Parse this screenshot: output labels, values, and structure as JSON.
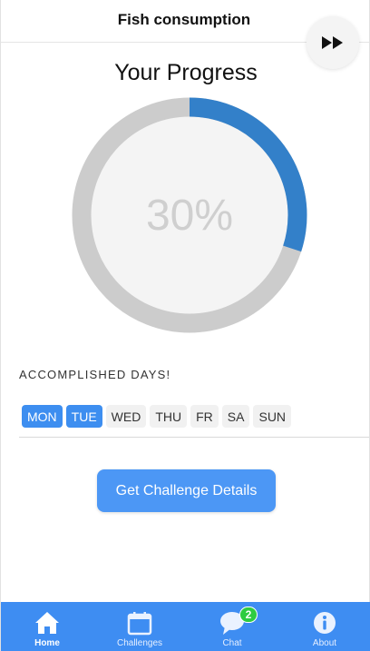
{
  "header": {
    "title": "Fish consumption"
  },
  "fast_forward_icon": "fast-forward-icon",
  "progress": {
    "title": "Your Progress",
    "percent_text": "30%",
    "value": 0.3,
    "color_filled": "#3380c9",
    "color_track": "#cccccc"
  },
  "days": {
    "label": "ACCOMPLISHED DAYS!",
    "items": [
      {
        "label": "MON",
        "active": true
      },
      {
        "label": "TUE",
        "active": true
      },
      {
        "label": "WED",
        "active": false
      },
      {
        "label": "THU",
        "active": false
      },
      {
        "label": "FR",
        "active": false
      },
      {
        "label": "SA",
        "active": false
      },
      {
        "label": "SUN",
        "active": false
      }
    ],
    "active_color": "#3d8ef0"
  },
  "cta": {
    "label": "Get Challenge Details"
  },
  "nav": {
    "items": [
      {
        "label": "Home",
        "icon": "home-icon",
        "active": true
      },
      {
        "label": "Challenges",
        "icon": "calendar-icon",
        "active": false
      },
      {
        "label": "Chat",
        "icon": "chat-icon",
        "active": false,
        "badge": "2"
      },
      {
        "label": "About",
        "icon": "info-icon",
        "active": false
      }
    ],
    "background": "#3e8df2"
  }
}
